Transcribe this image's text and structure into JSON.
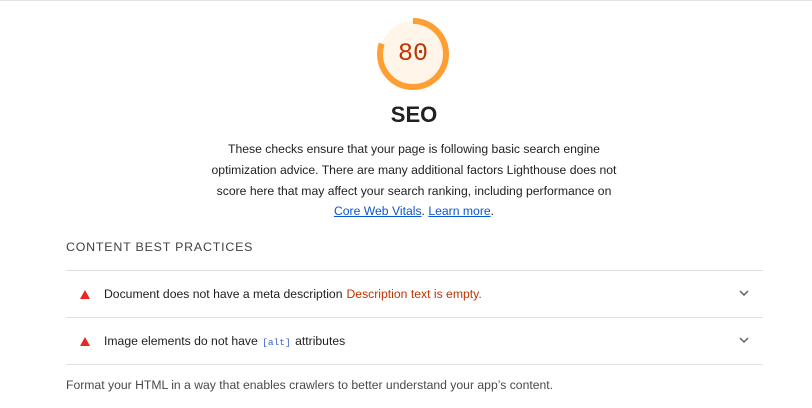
{
  "category": {
    "score": "80",
    "score_fraction": 0.8,
    "score_color": "#ff9f33",
    "score_bg": "#fff5e8",
    "title": "SEO",
    "description_part1": "These checks ensure that your page is following basic search engine optimization advice. There are many additional factors Lighthouse does not score here that may affect your search ranking, including performance on ",
    "link_core_web_vitals": "Core Web Vitals",
    "description_part2": ". ",
    "link_learn_more": "Learn more",
    "description_part3": "."
  },
  "group": {
    "title": "CONTENT BEST PRACTICES",
    "footer": "Format your HTML in a way that enables crawlers to better understand your app’s content."
  },
  "audits": [
    {
      "icon": "fail-triangle-icon",
      "title": "Document does not have a meta description",
      "display_value": "Description text is empty."
    },
    {
      "icon": "fail-triangle-icon",
      "title_before": "Image elements do not have ",
      "code": "[alt]",
      "title_after": " attributes"
    }
  ],
  "colors": {
    "fail": "#e8281f",
    "average": "#ff9f33",
    "link": "#0b57d0"
  }
}
